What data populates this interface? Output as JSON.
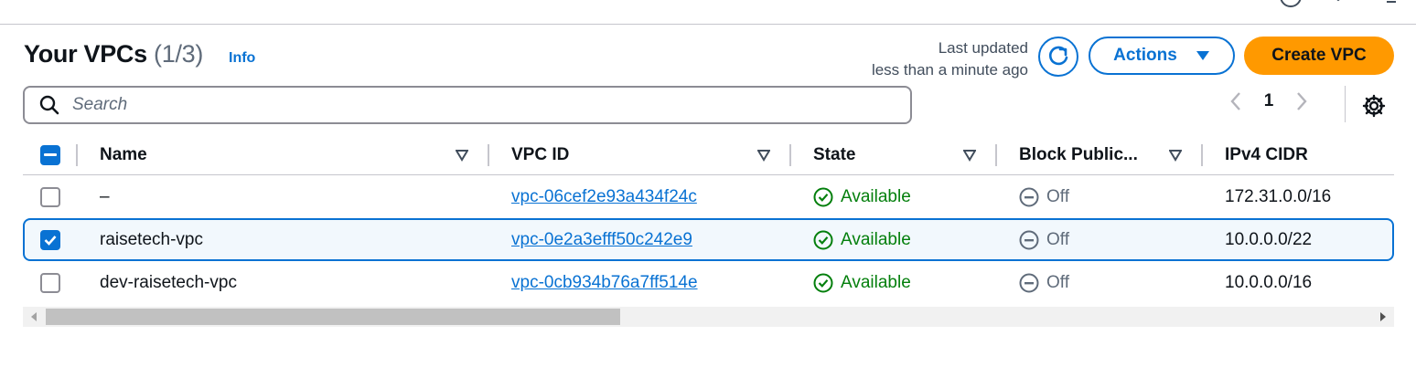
{
  "header": {
    "title": "Your VPCs",
    "count": "(1/3)",
    "info": "Info",
    "last_updated_line1": "Last updated",
    "last_updated_line2": "less than a minute ago",
    "actions_label": "Actions",
    "create_label": "Create VPC"
  },
  "search": {
    "placeholder": "Search",
    "value": ""
  },
  "pagination": {
    "current_page": "1"
  },
  "table": {
    "columns": [
      "Name",
      "VPC ID",
      "State",
      "Block Public...",
      "IPv4 CIDR"
    ],
    "rows": [
      {
        "name": "–",
        "vpc_id": "vpc-06cef2e93a434f24c",
        "state": "Available",
        "block_public": "Off",
        "ipv4_cidr": "172.31.0.0/16",
        "selected": false
      },
      {
        "name": "raisetech-vpc",
        "vpc_id": "vpc-0e2a3efff50c242e9",
        "state": "Available",
        "block_public": "Off",
        "ipv4_cidr": "10.0.0.0/22",
        "selected": true
      },
      {
        "name": "dev-raisetech-vpc",
        "vpc_id": "vpc-0cb934b76a7ff514e",
        "state": "Available",
        "block_public": "Off",
        "ipv4_cidr": "10.0.0.0/16",
        "selected": false
      }
    ]
  },
  "colors": {
    "link": "#0972d3",
    "primary": "#ff9900",
    "success": "#037f0c",
    "muted": "#5f6b7a"
  }
}
